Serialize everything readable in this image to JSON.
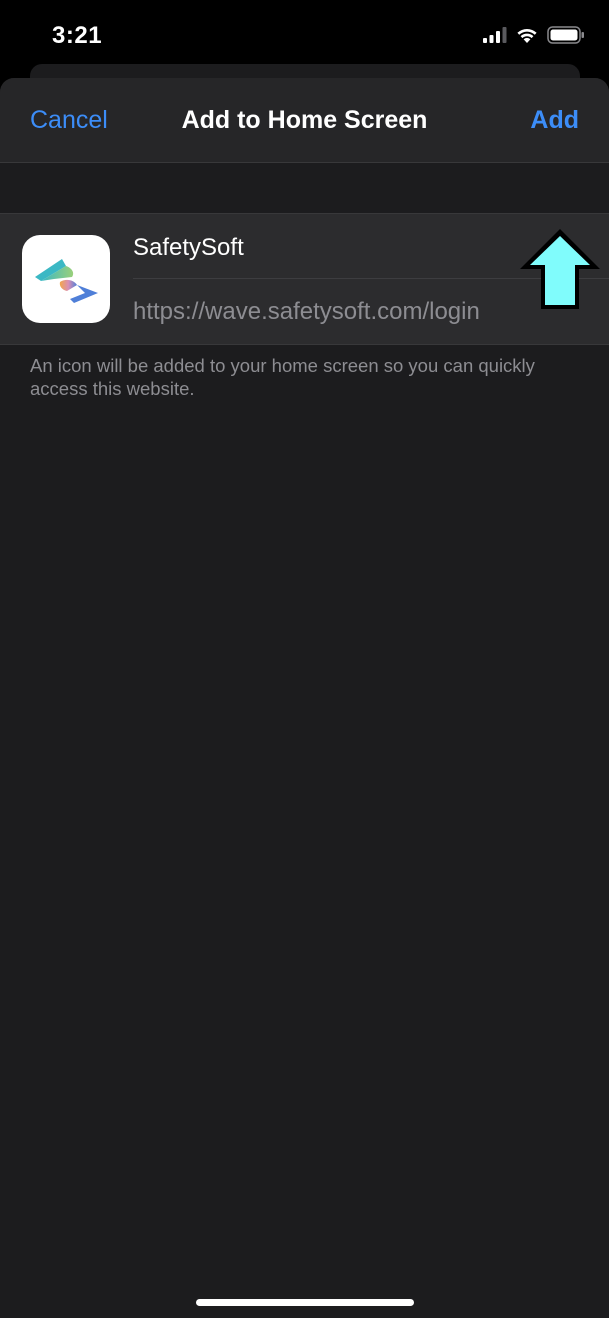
{
  "status_bar": {
    "time": "3:21",
    "icons": [
      "cellular-signal-icon",
      "wifi-icon",
      "battery-icon"
    ]
  },
  "sheet": {
    "nav": {
      "cancel_label": "Cancel",
      "title": "Add to Home Screen",
      "add_label": "Add"
    },
    "app": {
      "icon": "safetysoft-logo",
      "name": "SafetySoft",
      "url": "https://wave.safetysoft.com/login"
    },
    "footer_note": "An icon will be added to your home screen so you can quickly access this website."
  },
  "annotation": {
    "icon": "up-arrow-icon",
    "color": "#80fcfc"
  },
  "colors": {
    "accent": "#3c8df8",
    "sheet_background": "#1c1c1e",
    "nav_background": "#262628",
    "group_background": "#2c2c2e",
    "secondary_text": "#8d8d92"
  }
}
